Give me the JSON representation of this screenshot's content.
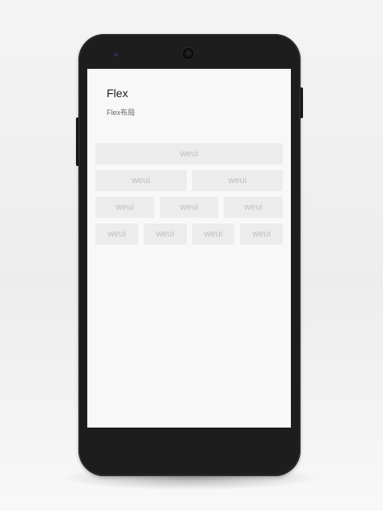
{
  "page": {
    "title": "Flex",
    "description": "Flex布局"
  },
  "grid": {
    "rows": [
      {
        "cells": [
          "weui"
        ]
      },
      {
        "cells": [
          "weui",
          "weui"
        ]
      },
      {
        "cells": [
          "weui",
          "weui",
          "weui"
        ]
      },
      {
        "cells": [
          "weui",
          "weui",
          "weui",
          "weui"
        ]
      }
    ]
  },
  "colors": {
    "phone_body": "#1d1d1d",
    "screen_bg": "#f8f8f8",
    "cell_bg": "#ececec",
    "cell_text": "#c0c0c0"
  },
  "icons": {
    "camera": "front-camera-icon",
    "sensor": "proximity-sensor-icon"
  }
}
